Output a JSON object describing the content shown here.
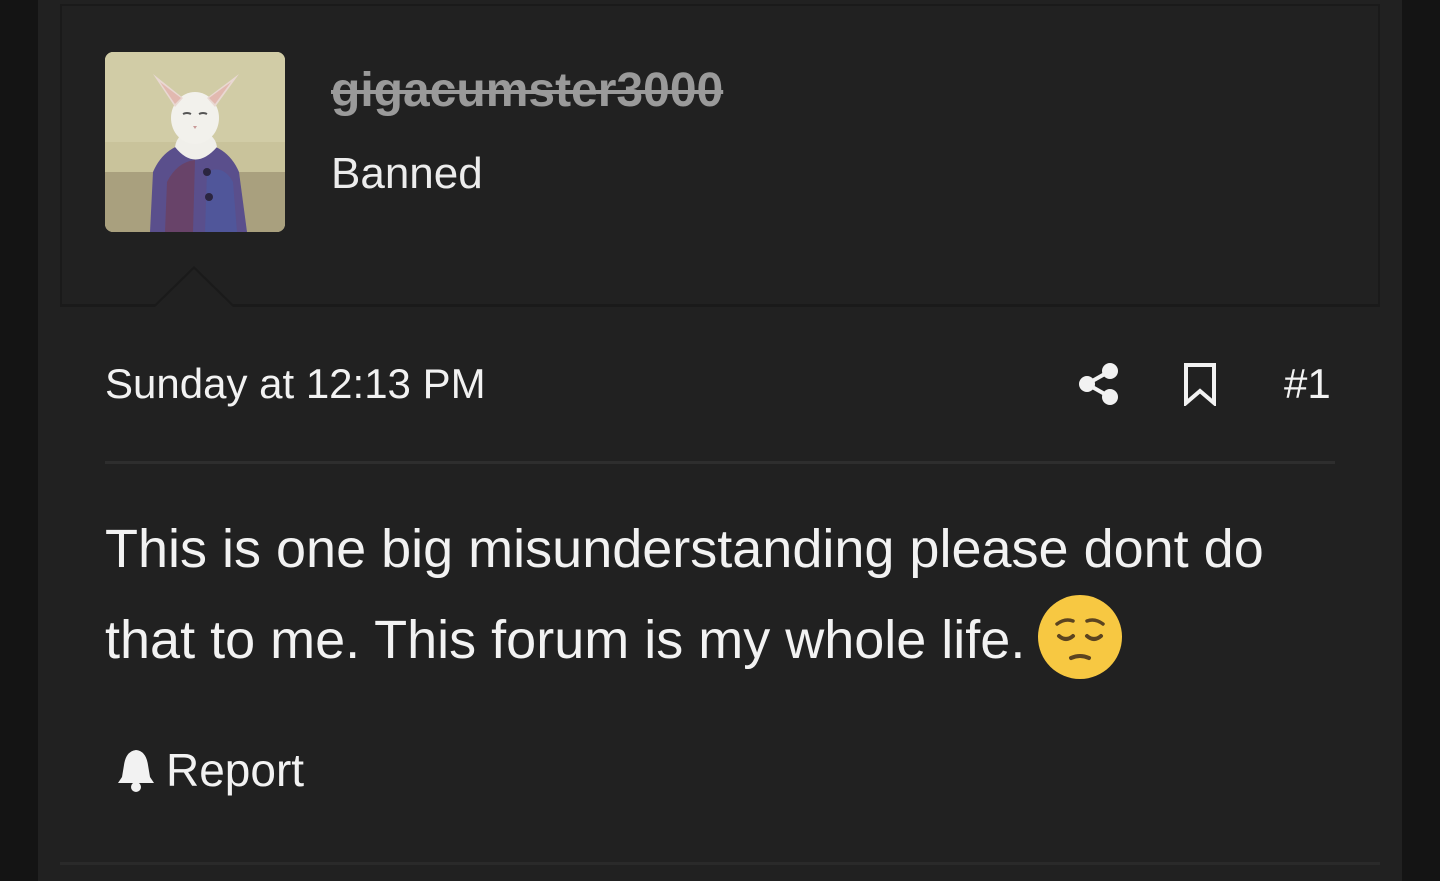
{
  "post": {
    "author": {
      "username": "gigacumster3000",
      "user_title": "Banned",
      "avatar_alt": "cat in sweater avatar"
    },
    "date": "Sunday at 12:13 PM",
    "number": "#1",
    "message": "This is one big misunderstanding please dont do that to me. This forum is my whole life.",
    "emoji": "pensive-face",
    "report_label": "Report"
  },
  "icons": {
    "share": "share-icon",
    "bookmark": "bookmark-icon",
    "report": "bell-icon"
  },
  "colors": {
    "background": "#141414",
    "post_background": "#212121",
    "text": "#f2f2f2",
    "banned_username": "#9a9a9a"
  }
}
